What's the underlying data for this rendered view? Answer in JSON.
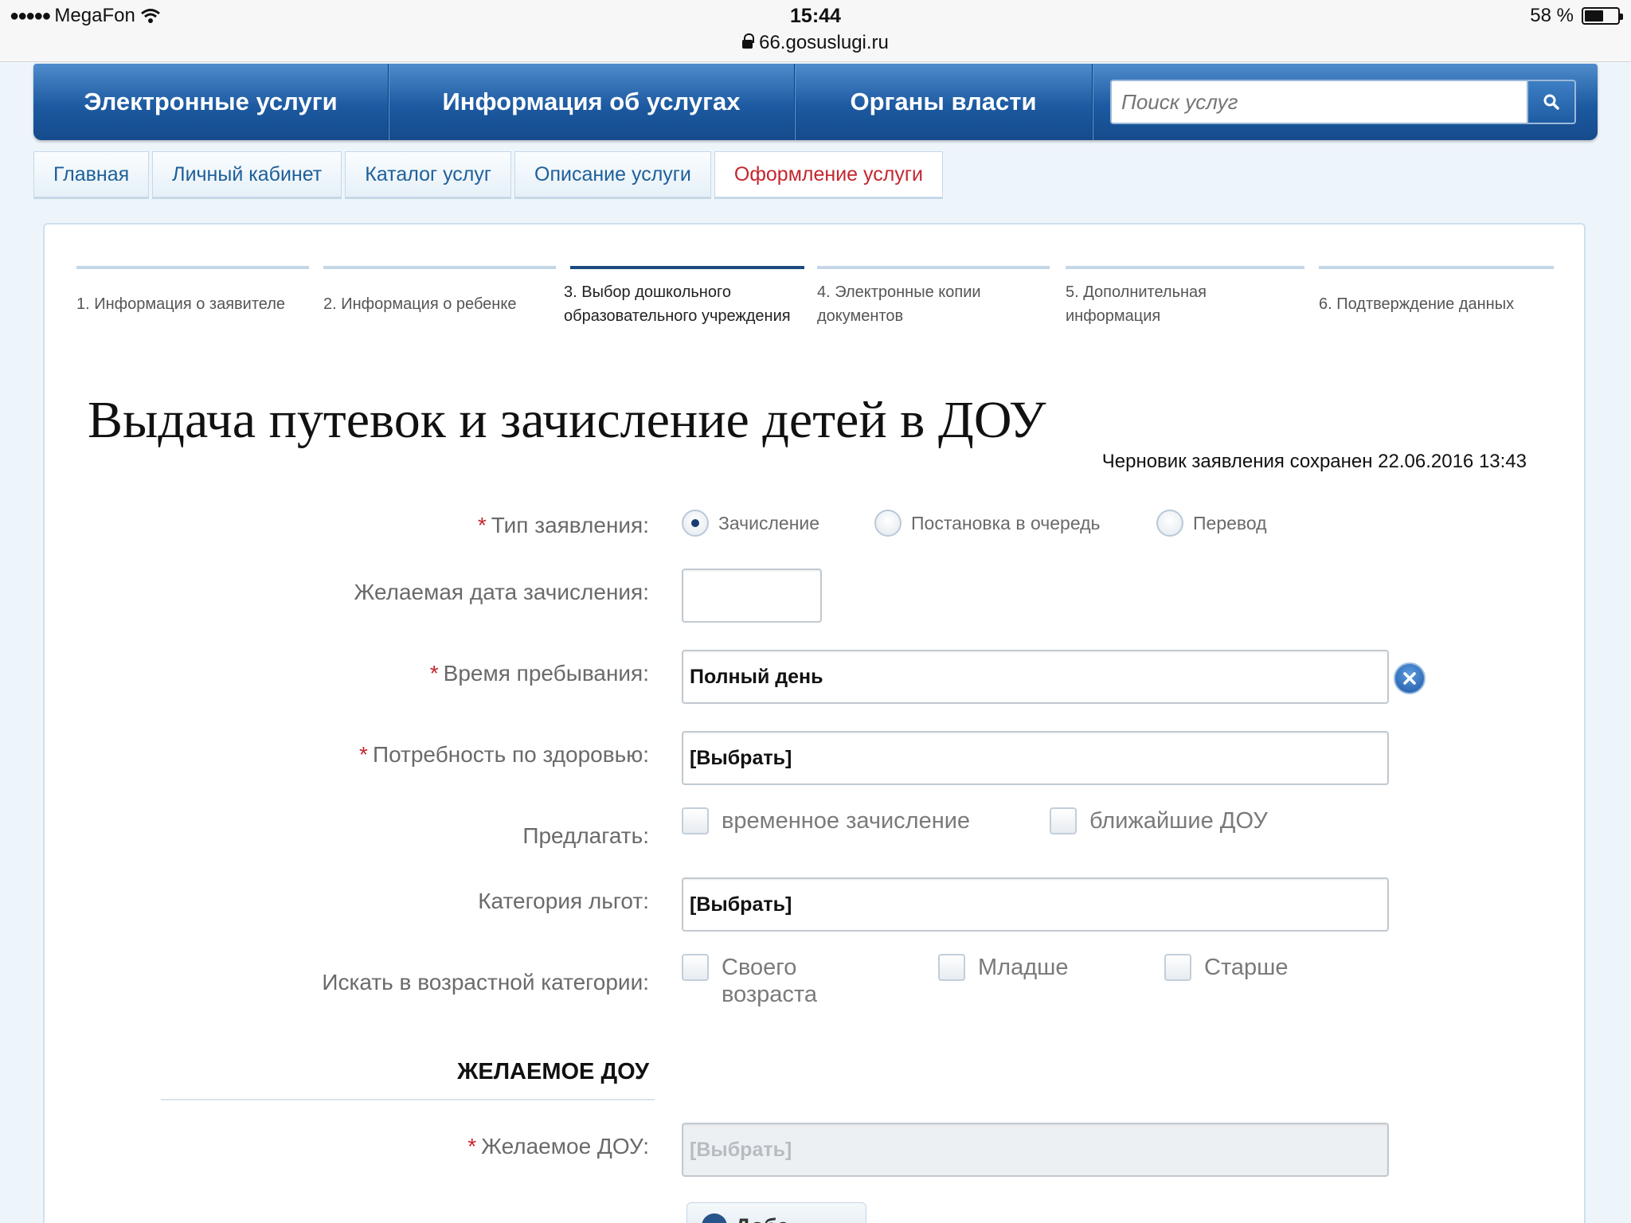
{
  "status_bar": {
    "carrier": "MegaFon",
    "time": "15:44",
    "url": "66.gosuslugi.ru",
    "battery_text": "58 %",
    "battery_level": 0.58
  },
  "topnav": {
    "items": [
      "Электронные услуги",
      "Информация об услугах",
      "Органы власти"
    ],
    "search_placeholder": "Поиск услуг"
  },
  "breadcrumb": [
    "Главная",
    "Личный кабинет",
    "Каталог услуг",
    "Описание услуги",
    "Оформление услуги"
  ],
  "steps": [
    {
      "label": "1. Информация о заявителе"
    },
    {
      "label": "2. Информация о ребенке"
    },
    {
      "label": "3. Выбор дошкольного образовательного учреждения"
    },
    {
      "label": "4. Электронные копии документов"
    },
    {
      "label": "5. Дополнительная информация"
    },
    {
      "label": "6. Подтверждение данных"
    }
  ],
  "active_step": 3,
  "page_title": "Выдача путевок и зачисление детей в ДОУ",
  "draft_status": "Черновик заявления сохранен 22.06.2016 13:43",
  "form": {
    "application_type": {
      "label": "Тип заявления:",
      "options": [
        "Зачисление",
        "Постановка в очередь",
        "Перевод"
      ],
      "selected": "Зачисление"
    },
    "desired_date": {
      "label": "Желаемая дата зачисления:",
      "value": ""
    },
    "stay_time": {
      "label": "Время пребывания:",
      "value": "Полный день"
    },
    "health_needs": {
      "label": "Потребность по здоровью:",
      "value": "[Выбрать]"
    },
    "offer": {
      "label": "Предлагать:",
      "options": [
        "временное зачисление",
        "ближайшие ДОУ"
      ]
    },
    "benefits": {
      "label": "Категория льгот:",
      "value": "[Выбрать]"
    },
    "age_category": {
      "label": "Искать в возрастной категории:",
      "options": [
        "Своего возраста",
        "Младше",
        "Старше"
      ]
    },
    "section_title": "ЖЕЛАЕМОЕ ДОУ",
    "desired_dou": {
      "label": "Желаемое ДОУ:",
      "value": "[Выбрать]"
    },
    "add_button": "Доба..."
  }
}
